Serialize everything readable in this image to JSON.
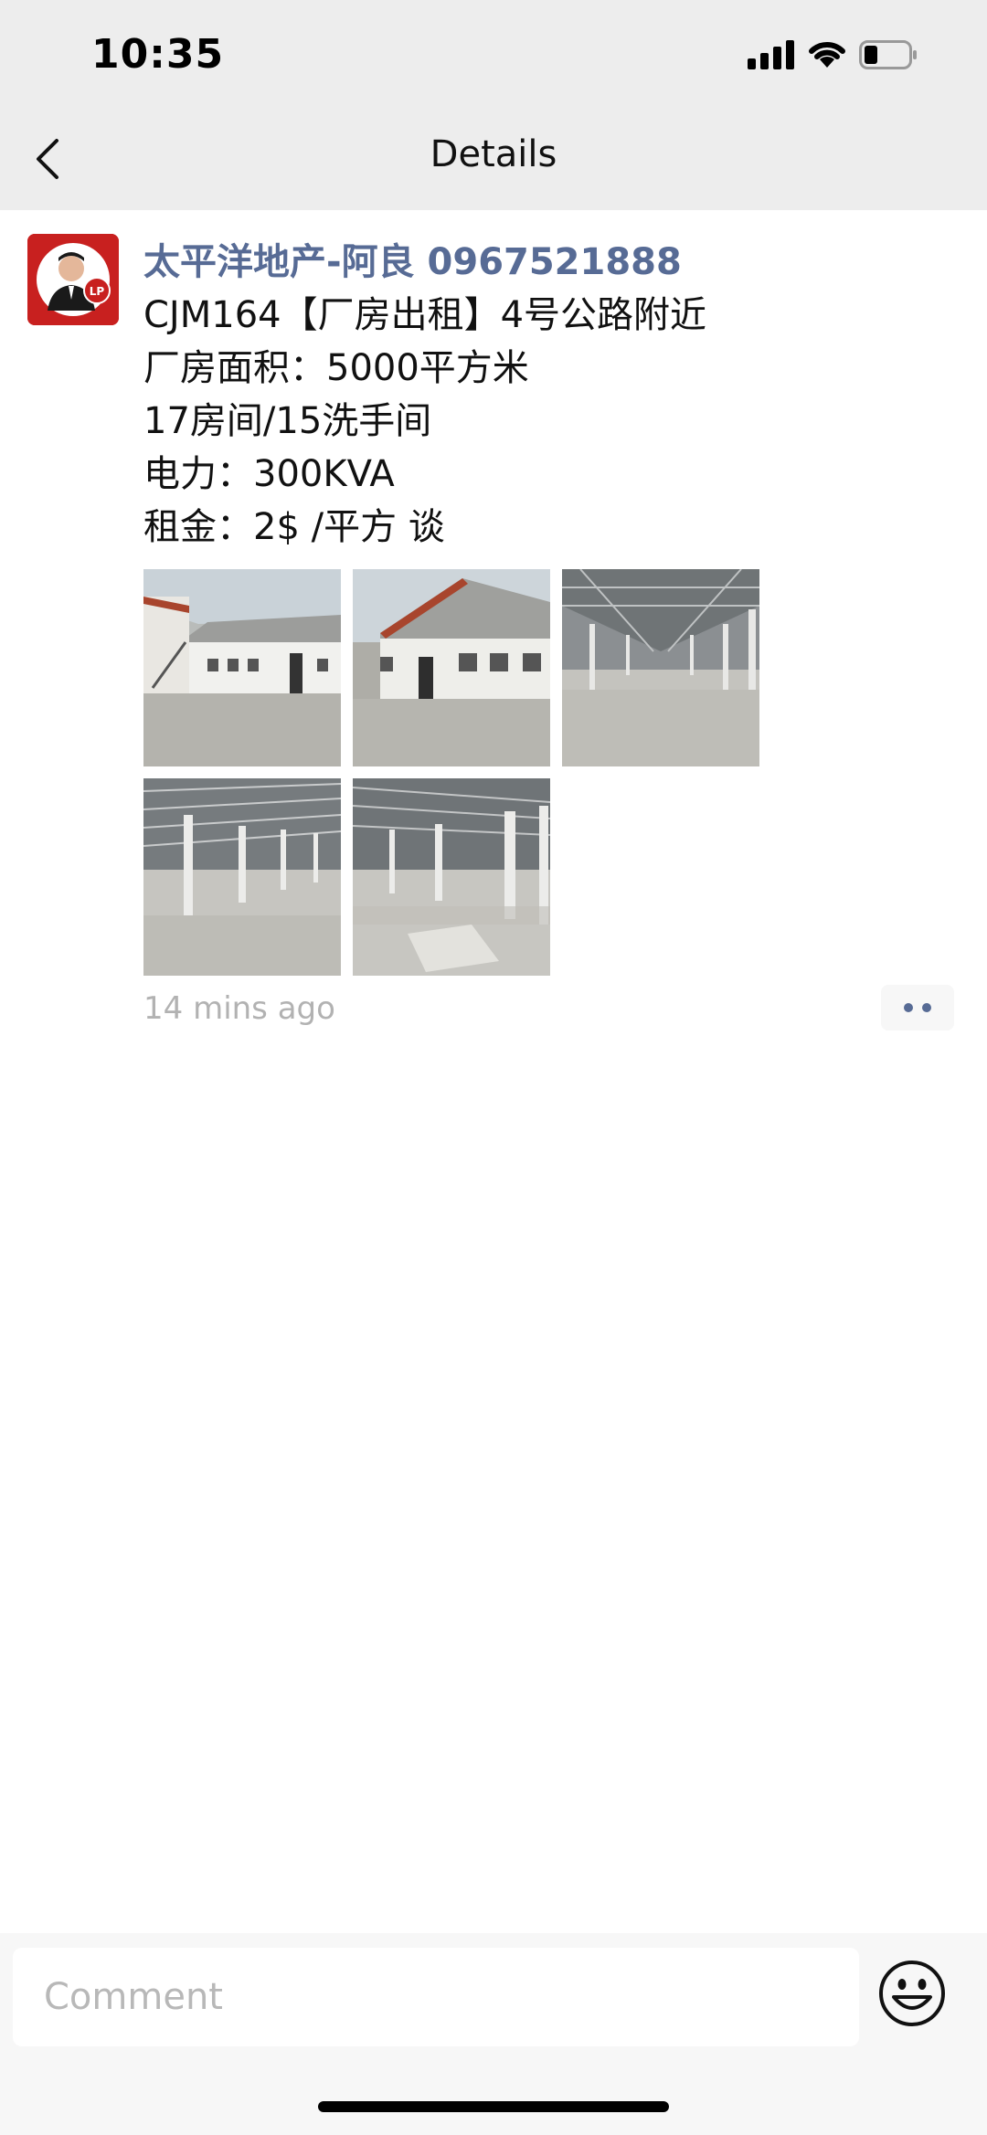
{
  "status_bar": {
    "time": "10:35"
  },
  "nav": {
    "title": "Details",
    "back_icon": "chevron-left-icon"
  },
  "post": {
    "author": "太平洋地产-阿良 0967521888",
    "avatar_badge": "LP",
    "lines": [
      "CJM164【厂房出租】4号公路附近",
      "厂房面积：5000平方米",
      "17房间/15洗手间",
      "电力：300KVA",
      "租金：2$ /平方 谈"
    ],
    "photos": [
      "warehouse-exterior-1",
      "warehouse-exterior-2",
      "warehouse-interior-1",
      "warehouse-interior-2",
      "warehouse-interior-3"
    ],
    "timestamp": "14 mins ago",
    "more_icon": "more-dots-icon"
  },
  "comment_bar": {
    "placeholder": "Comment",
    "emoji_icon": "smiley-face-icon"
  },
  "colors": {
    "link_blue": "#576b95",
    "bar_gray": "#ededed",
    "timestamp_gray": "#b2b2b2",
    "avatar_red": "#d42a2a"
  }
}
